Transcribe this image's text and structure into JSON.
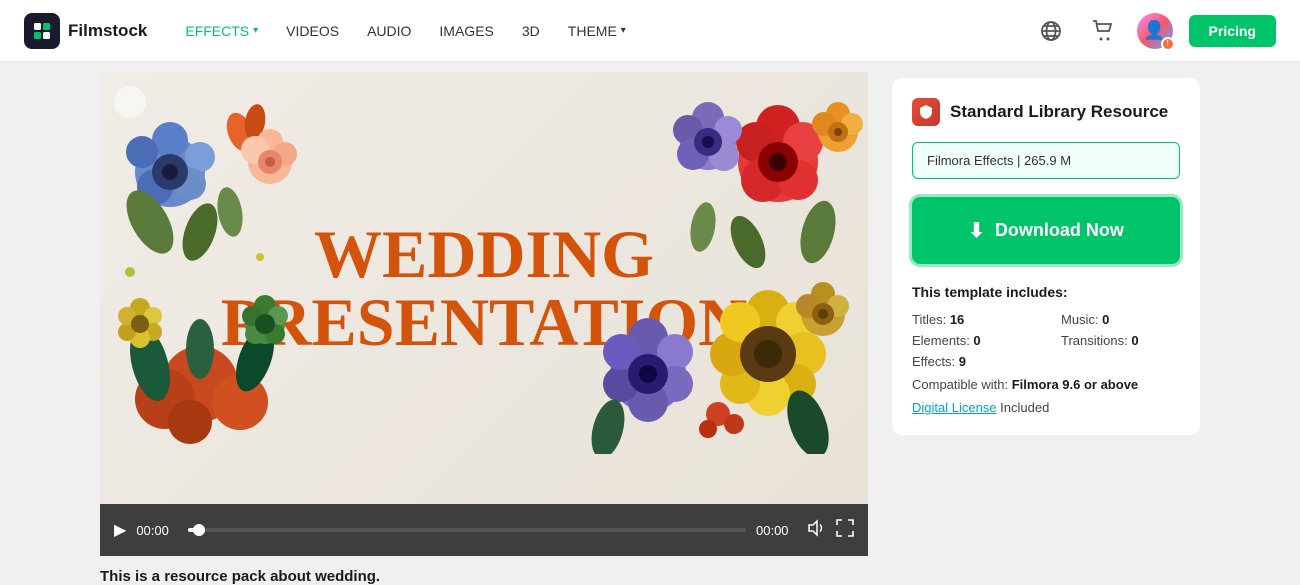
{
  "nav": {
    "logo_text": "Filmstock",
    "items": [
      {
        "label": "EFFECTS",
        "has_chevron": true,
        "active": true
      },
      {
        "label": "VIDEOS",
        "has_chevron": false,
        "active": false
      },
      {
        "label": "AUDIO",
        "has_chevron": false,
        "active": false
      },
      {
        "label": "IMAGES",
        "has_chevron": false,
        "active": false
      },
      {
        "label": "3D",
        "has_chevron": false,
        "active": false
      },
      {
        "label": "THEME",
        "has_chevron": true,
        "active": false
      }
    ],
    "pricing_label": "Pricing"
  },
  "video": {
    "title_line1": "WEDDING",
    "title_line2": "PRESENTATION",
    "time_current": "00:00",
    "time_total": "00:00"
  },
  "description": "This is a resource pack about wedding.",
  "panel": {
    "resource_badge": "🛡",
    "resource_title": "Standard Library Resource",
    "file_label": "Filmora Effects | 265.9 M",
    "download_label": "Download Now",
    "template_includes_label": "This template includes:",
    "stats": [
      {
        "key": "Titles:",
        "value": "16"
      },
      {
        "key": "Music:",
        "value": "0"
      },
      {
        "key": "Elements:",
        "value": "0"
      },
      {
        "key": "Transitions:",
        "value": "0"
      },
      {
        "key": "Effects:",
        "value": "9"
      }
    ],
    "compat_prefix": "Compatible with: ",
    "compat_value": "Filmora 9.6 or above",
    "license_link": "Digital License",
    "license_suffix": " Included"
  }
}
